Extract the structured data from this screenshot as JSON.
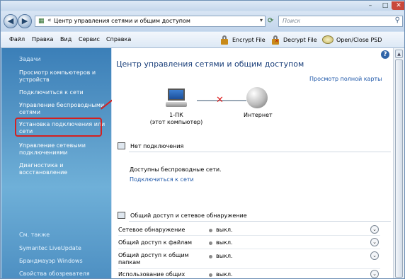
{
  "address": {
    "path": "Центр управления сетями и общим доступом",
    "separator": "«"
  },
  "search": {
    "placeholder": "Поиск"
  },
  "menubar": {
    "items": [
      "Файл",
      "Правка",
      "Вид",
      "Сервис",
      "Справка"
    ],
    "tools": [
      {
        "label": "Encrypt File",
        "icon": "lock-icon"
      },
      {
        "label": "Decrypt File",
        "icon": "unlock-icon"
      },
      {
        "label": "Open/Close PSD",
        "icon": "disk-icon"
      }
    ]
  },
  "sidebar": {
    "title": "Задачи",
    "tasks": [
      "Просмотр компьютеров и устройств",
      "Подключиться к сети",
      "Управление беспроводными сетями",
      "Установка подключения или сети",
      "Управление сетевыми подключениями",
      "Диагностика и восстановление"
    ],
    "see_also_title": "См. также",
    "see_also": [
      "Symantec LiveUpdate",
      "Брандмауэр Windows",
      "Свойства обозревателя"
    ]
  },
  "main": {
    "title": "Центр управления сетями и общим доступом",
    "full_map": "Просмотр полной карты",
    "computer_name": "1-ПК",
    "computer_sub": "(этот компьютер)",
    "internet": "Интернет",
    "status_header": "Нет подключения",
    "wireless": "Доступны беспроводные сети.",
    "connect_link": "Подключиться к сети",
    "sharing_header": "Общий доступ и сетевое обнаружение",
    "settings": [
      {
        "label": "Сетевое обнаружение",
        "value": "выкл."
      },
      {
        "label": "Общий доступ к файлам",
        "value": "выкл."
      },
      {
        "label": "Общий доступ к общим папкам",
        "value": "выкл."
      },
      {
        "label": "Использование общих",
        "value": "выкл."
      }
    ]
  },
  "colors": {
    "accent": "#1c56a8",
    "highlight": "#d42020",
    "sidebar": "#4d8fc2"
  }
}
